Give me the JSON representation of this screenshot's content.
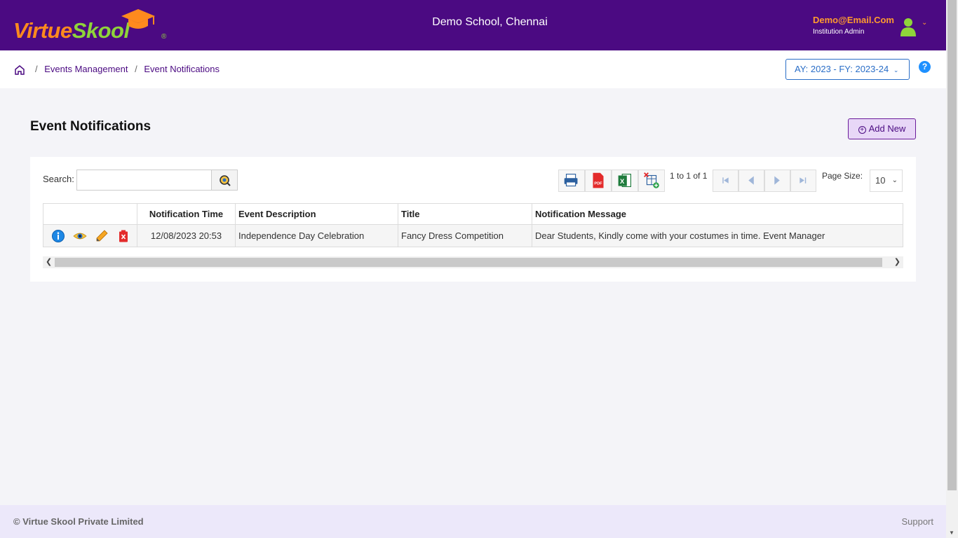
{
  "header": {
    "logo_primary": "Virtue",
    "logo_secondary": "Skool",
    "logo_reg": "®",
    "school_name": "Demo School, Chennai",
    "user_email": "Demo@Email.Com",
    "user_role": "Institution Admin",
    "colors": {
      "bg": "#4b0a82",
      "logo_orange": "#ff8a1e",
      "logo_green": "#8fd43a"
    }
  },
  "breadcrumb": {
    "items": [
      "Events Management",
      "Event Notifications"
    ],
    "separator": "/"
  },
  "year_selector": {
    "label": "AY: 2023 - FY: 2023-24"
  },
  "help": {
    "label": "?"
  },
  "page": {
    "title": "Event Notifications",
    "add_new_label": "Add New"
  },
  "toolbar": {
    "search_label": "Search:",
    "search_value": "",
    "export_icons": [
      "print-icon",
      "pdf-icon",
      "excel-icon",
      "column-chooser-icon"
    ],
    "pager_text": "1 to 1 of 1",
    "page_size_label": "Page Size:",
    "page_size_value": "10"
  },
  "table": {
    "columns": [
      "",
      "Notification Time",
      "Event Description",
      "Title",
      "Notification Message"
    ],
    "rows": [
      {
        "actions": [
          "info-icon",
          "view-icon",
          "edit-icon",
          "delete-icon"
        ],
        "notification_time": "12/08/2023 20:53",
        "event_description": "Independence Day Celebration",
        "title": "Fancy Dress Competition",
        "message": "Dear Students,  Kindly come with your costumes in time.  Event Manager"
      }
    ]
  },
  "footer": {
    "copyright": "© Virtue Skool Private Limited",
    "support": "Support"
  }
}
